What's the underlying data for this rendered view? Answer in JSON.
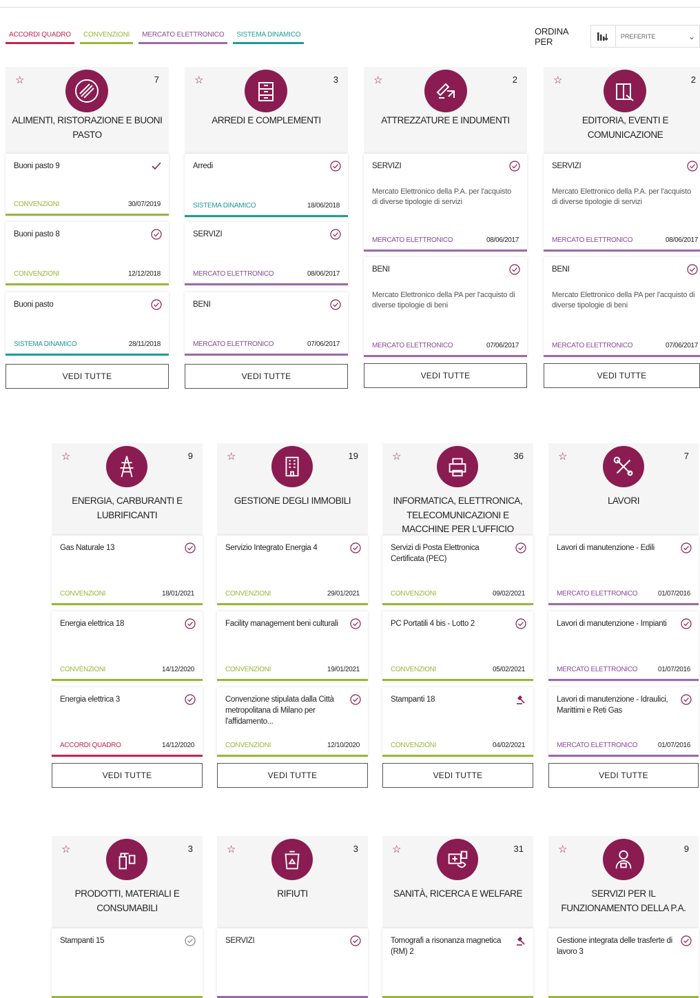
{
  "legend": [
    "ACCORDI QUADRO",
    "CONVENZIONI",
    "MERCATO ELETTRONICO",
    "SISTEMA DINAMICO"
  ],
  "colors": {
    "accordi_quadro": "#c0284e",
    "convenzioni": "#9bb539",
    "mercato_elettronico": "#9a6aa6",
    "sistema_dinamico": "#1d9c96",
    "brand": "#8a1c52"
  },
  "sort": {
    "label": "ORDINA PER",
    "value": "PREFERITE"
  },
  "labels": {
    "vedi_tutte": "VEDI TUTTE"
  },
  "grid": [
    {
      "title": "ALIMENTI, RISTORAZIONE E BUONI PASTO",
      "count": "7",
      "icon": "food-icon",
      "items": [
        {
          "title": "Buoni pasto 9",
          "type": "CONVENZIONI",
          "date": "30/07/2019"
        },
        {
          "title": "Buoni pasto 8",
          "type": "CONVENZIONI",
          "date": "12/12/2018"
        },
        {
          "title": "Buoni pasto",
          "type": "SISTEMA DINAMICO",
          "date": "28/11/2018"
        }
      ]
    },
    {
      "title": "ARREDI E COMPLEMENTI",
      "count": "3",
      "icon": "furniture-icon",
      "items": [
        {
          "title": "Arredi",
          "type": "SISTEMA DINAMICO",
          "date": "18/06/2018"
        },
        {
          "title": "SERVIZI",
          "type": "MERCATO ELETTRONICO",
          "date": "08/06/2017"
        },
        {
          "title": "BENI",
          "type": "MERCATO ELETTRONICO",
          "date": "07/06/2017"
        }
      ]
    },
    {
      "title": "ATTREZZATURE E INDUMENTI",
      "count": "2",
      "icon": "tools-icon",
      "items": [
        {
          "title": "SERVIZI",
          "desc": "Mercato Elettronico della P.A. per l'acquisto di diverse tipologie di servizi",
          "type": "MERCATO ELETTRONICO",
          "date": "08/06/2017"
        },
        {
          "title": "BENI",
          "desc": "Mercato Elettronico della PA per l'acquisto di diverse tipologie di beni",
          "type": "MERCATO ELETTRONICO",
          "date": "07/06/2017"
        }
      ]
    },
    {
      "title": "EDITORIA, EVENTI E COMUNICAZIONE",
      "count": "2",
      "icon": "book-icon",
      "items": [
        {
          "title": "SERVIZI",
          "desc": "Mercato Elettronico della P.A. per l'acquisto di diverse tipologie di servizi",
          "type": "MERCATO ELETTRONICO",
          "date": "08/06/2017"
        },
        {
          "title": "BENI",
          "desc": "Mercato Elettronico della PA per l'acquisto di diverse tipologie di beni",
          "type": "MERCATO ELETTRONICO",
          "date": "07/06/2017"
        }
      ]
    },
    {
      "title": "ENERGIA, CARBURANTI E LUBRIFICANTI",
      "count": "9",
      "icon": "power-tower-icon",
      "items": [
        {
          "title": "Gas Naturale 13",
          "type": "CONVENZIONI",
          "date": "18/01/2021"
        },
        {
          "title": "Energia elettrica 18",
          "type": "CONVENZIONI",
          "date": "14/12/2020"
        },
        {
          "title": "Energia elettrica 3",
          "type": "ACCORDI QUADRO",
          "date": "14/12/2020"
        }
      ]
    },
    {
      "title": "GESTIONE DEGLI IMMOBILI",
      "count": "19",
      "icon": "building-icon",
      "items": [
        {
          "title": "Servizio Integrato Energia 4",
          "type": "CONVENZIONI",
          "date": "29/01/2021"
        },
        {
          "title": "Facility management beni culturali",
          "type": "CONVENZIONI",
          "date": "19/01/2021"
        },
        {
          "title": "Convenzione stipulata dalla Città metropolitana di Milano per l'affidamento...",
          "type": "CONVENZIONI",
          "date": "12/10/2020"
        }
      ]
    },
    {
      "title": "INFORMATICA, ELETTRONICA, TELECOMUNICAZIONI E MACCHINE PER L'UFFICIO",
      "count": "36",
      "icon": "printer-icon",
      "items": [
        {
          "title": "Servizi di Posta Elettronica Certificata (PEC)",
          "type": "CONVENZIONI",
          "date": "09/02/2021"
        },
        {
          "title": "PC Portatili 4 bis - Lotto 2",
          "type": "CONVENZIONI",
          "date": "05/02/2021"
        },
        {
          "title": "Stampanti 18",
          "type": "CONVENZIONI",
          "date": "04/02/2021"
        }
      ]
    },
    {
      "title": "LAVORI",
      "count": "7",
      "icon": "wrench-screwdriver-icon",
      "items": [
        {
          "title": "Lavori di manutenzione - Edili",
          "type": "MERCATO ELETTRONICO",
          "date": "01/07/2016"
        },
        {
          "title": "Lavori di manutenzione - Impianti",
          "type": "MERCATO ELETTRONICO",
          "date": "01/07/2016"
        },
        {
          "title": "Lavori di manutenzione - Idraulici, Marittimi e Reti Gas",
          "type": "MERCATO ELETTRONICO",
          "date": "01/07/2016"
        }
      ]
    },
    {
      "title": "PRODOTTI, MATERIALI E CONSUMABILI",
      "count": "3",
      "icon": "spray-bottle-icon",
      "items": [
        {
          "title": "Stampanti 15"
        }
      ]
    },
    {
      "title": "RIFIUTI",
      "count": "3",
      "icon": "recycle-bin-icon",
      "items": [
        {
          "title": "SERVIZI"
        }
      ]
    },
    {
      "title": "SANITÀ, RICERCA E WELFARE",
      "count": "31",
      "icon": "medical-kit-icon",
      "items": [
        {
          "title": "Tomografi a risonanza magnetica (RM) 2"
        }
      ]
    },
    {
      "title": "SERVIZI PER IL FUNZIONAMENTO DELLA P.A.",
      "count": "9",
      "icon": "office-worker-icon",
      "items": [
        {
          "title": "Gestione integrata delle trasferte di lavoro 3"
        }
      ]
    }
  ]
}
